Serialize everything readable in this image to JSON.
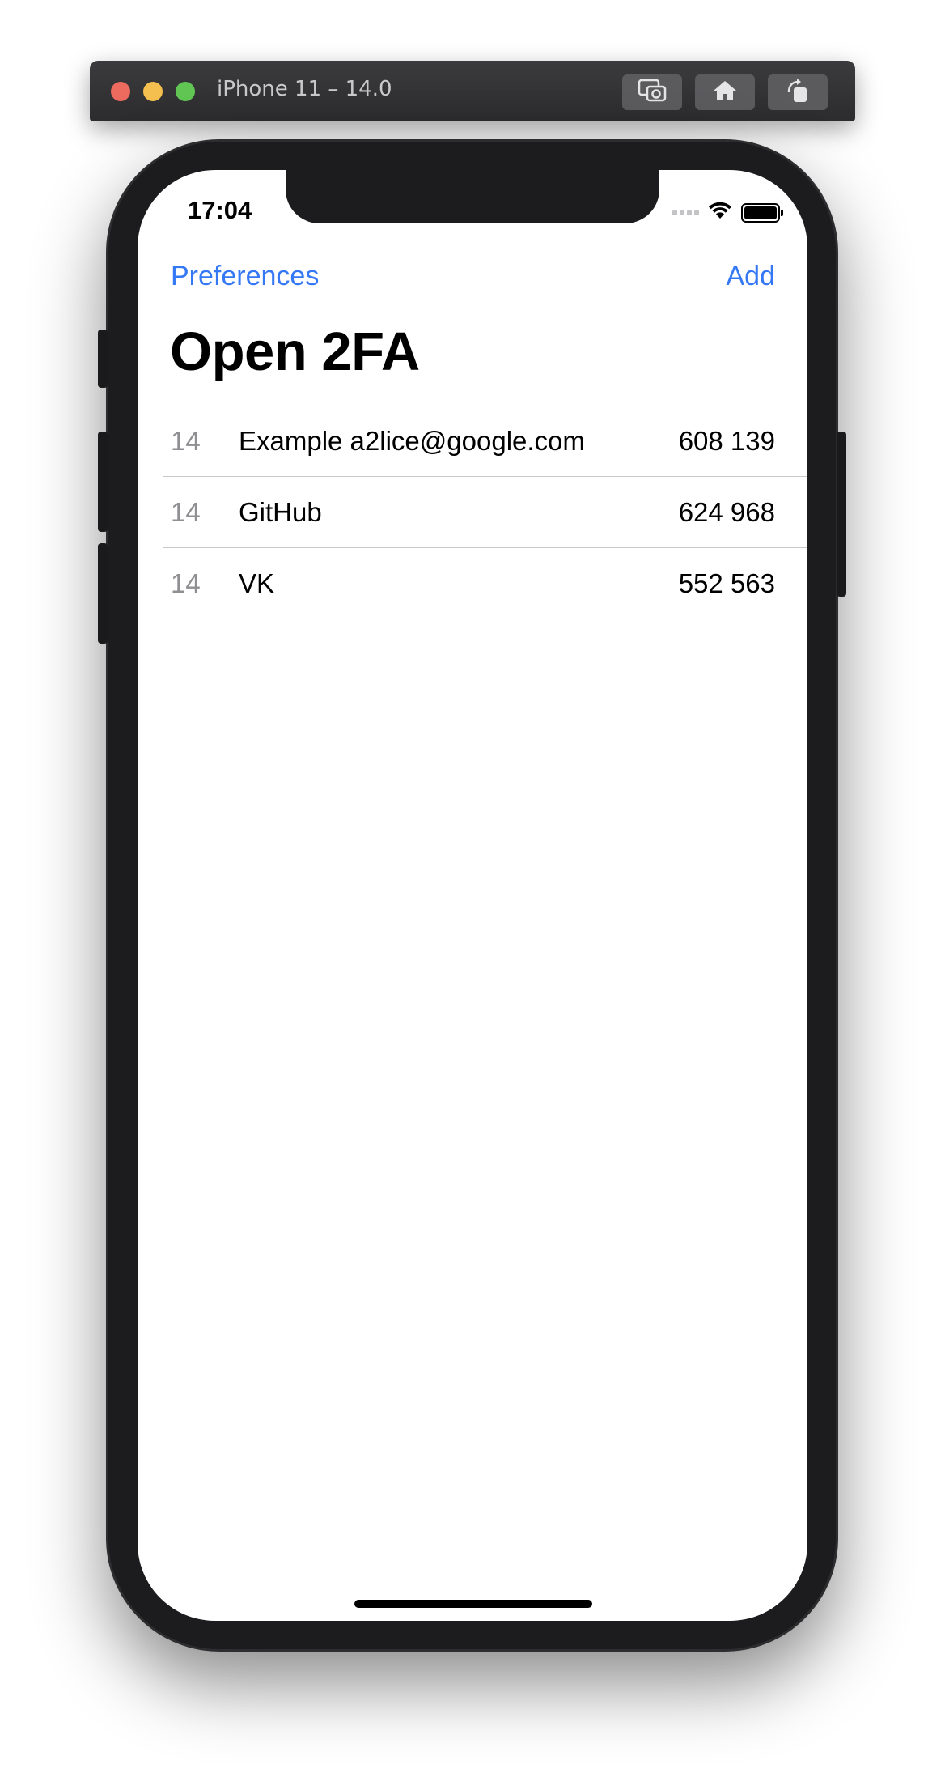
{
  "simulator": {
    "title": "iPhone 11 – 14.0",
    "buttons": [
      {
        "icon": "screenshot-icon"
      },
      {
        "icon": "home-icon"
      },
      {
        "icon": "rotate-icon"
      }
    ]
  },
  "status_bar": {
    "time": "17:04",
    "icons": [
      "cellular-signal-icon",
      "wifi-icon",
      "battery-icon"
    ]
  },
  "nav": {
    "left_label": "Preferences",
    "right_label": "Add",
    "title": "Open 2FA"
  },
  "accounts": [
    {
      "timer": "14",
      "name": "Example a2lice@google.com",
      "code": "608 139"
    },
    {
      "timer": "14",
      "name": "GitHub",
      "code": "624 968"
    },
    {
      "timer": "14",
      "name": "VK",
      "code": "552 563"
    }
  ],
  "colors": {
    "accent": "#3478f6",
    "secondary_text": "#8e8e93",
    "separator": "#c8c7cc",
    "bezel": "#1c1c1e"
  }
}
